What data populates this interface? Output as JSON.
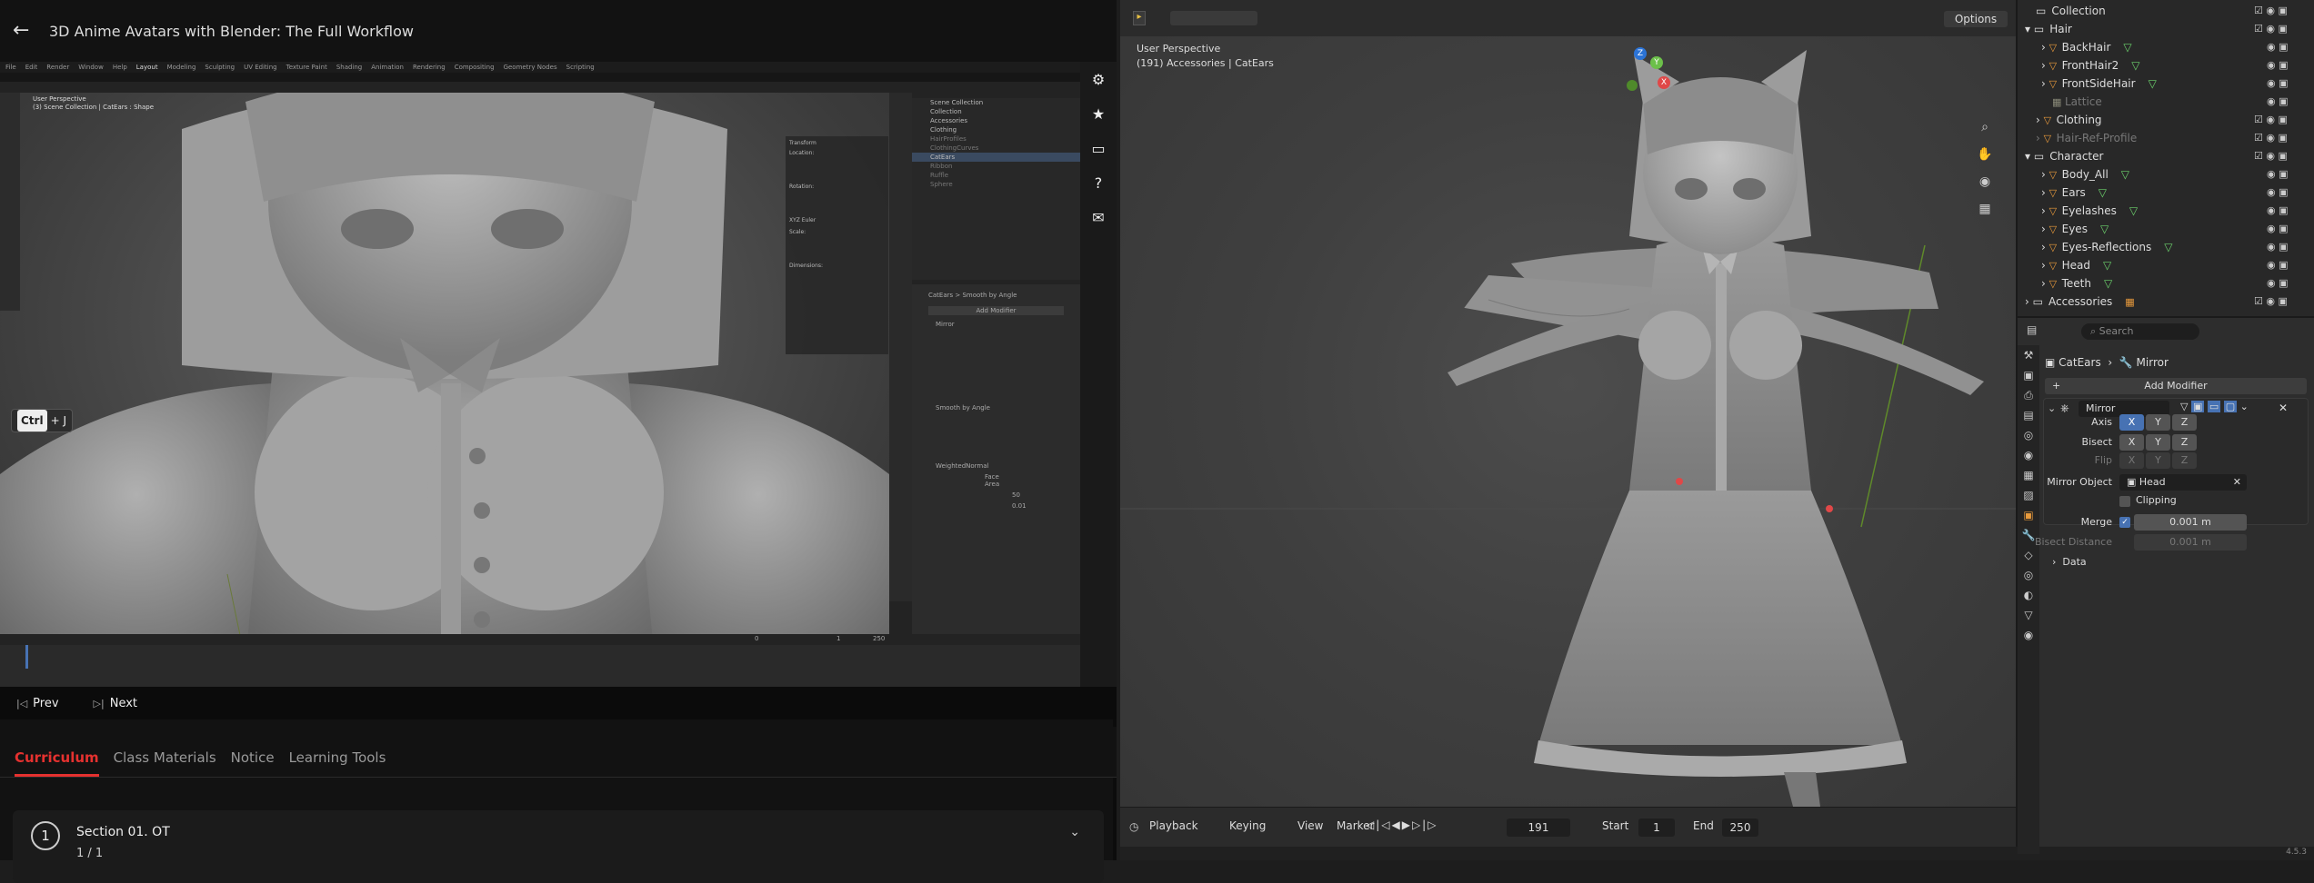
{
  "course": {
    "title": "3D Anime Avatars with Blender: The Full Workflow"
  },
  "video": {
    "menubar": [
      "File",
      "Edit",
      "Render",
      "Window",
      "Help",
      "Layout",
      "Modeling",
      "Sculpting",
      "UV Editing",
      "Texture Paint",
      "Shading",
      "Animation",
      "Rendering",
      "Compositing",
      "Geometry Nodes",
      "Scripting"
    ],
    "viewport_info": [
      "User Perspective",
      "(3) Scene Collection | CatEars : Shape"
    ],
    "shortcut": {
      "key": "Ctrl",
      "plus": "+ J"
    },
    "outliner": [
      "Scene Collection",
      "Collection",
      "Accessories",
      "Clothing",
      "HairProfiles",
      "ClothingCurves",
      "CatEars",
      "Ribbon",
      "Ruffle",
      "Sphere"
    ],
    "props": {
      "breadcrumb": "CatEars  >  Smooth by Angle",
      "add_modifier": "Add Modifier",
      "mirror": "Mirror",
      "smooth": "Smooth by Angle",
      "weighted": "WeightedNormal",
      "weighting_mode": "Face Area",
      "weight": "50",
      "threshold": "0.01"
    },
    "transform": {
      "title": "Transform",
      "location": "Location:",
      "rotation": "Rotation:",
      "scale": "Scale:",
      "dimensions": "Dimensions:",
      "rotation_mode": "XYZ Euler"
    },
    "timeline": {
      "frame": "0",
      "start": "1",
      "end": "250"
    }
  },
  "nav": {
    "prev": "Prev",
    "next": "Next"
  },
  "tabs": [
    {
      "label": "Curriculum",
      "active": true
    },
    {
      "label": "Class Materials",
      "active": false
    },
    {
      "label": "Notice",
      "active": false
    },
    {
      "label": "Learning Tools",
      "active": false
    }
  ],
  "section": {
    "num": "1",
    "title": "Section 01. OT",
    "progress": "1 / 1"
  },
  "blender": {
    "options_label": "Options",
    "viewport_info": [
      "User Perspective",
      "(191) Accessories | CatEars"
    ],
    "gizmo": {
      "x": "X",
      "y": "Y",
      "z": "Z"
    },
    "timeline": {
      "playback": "Playback",
      "keying": "Keying",
      "view": "View",
      "marker": "Marker",
      "frame": "191",
      "start_label": "Start",
      "start": "1",
      "end_label": "End",
      "end": "250"
    },
    "version": "4.5.3",
    "outliner": [
      {
        "label": "Collection",
        "indent": 1,
        "dim": false
      },
      {
        "label": "Hair",
        "indent": 1,
        "dim": false
      },
      {
        "label": "BackHair",
        "indent": 2,
        "dim": false
      },
      {
        "label": "FrontHair2",
        "indent": 2,
        "dim": false
      },
      {
        "label": "FrontSideHair",
        "indent": 2,
        "dim": false
      },
      {
        "label": "Lattice",
        "indent": 2,
        "dim": true
      },
      {
        "label": "Clothing",
        "indent": 1,
        "dim": false
      },
      {
        "label": "Hair-Ref-Profile",
        "indent": 1,
        "dim": true
      },
      {
        "label": "Character",
        "indent": 1,
        "dim": false
      },
      {
        "label": "Body_All",
        "indent": 2,
        "dim": false
      },
      {
        "label": "Ears",
        "indent": 2,
        "dim": false
      },
      {
        "label": "Eyelashes",
        "indent": 2,
        "dim": false
      },
      {
        "label": "Eyes",
        "indent": 2,
        "dim": false
      },
      {
        "label": "Eyes-Reflections",
        "indent": 2,
        "dim": false
      },
      {
        "label": "Head",
        "indent": 2,
        "dim": false
      },
      {
        "label": "Teeth",
        "indent": 2,
        "dim": false
      },
      {
        "label": "Accessories",
        "indent": 1,
        "dim": false
      }
    ],
    "props": {
      "search_placeholder": "Search",
      "obj": "CatEars",
      "modifier": "Mirror",
      "add_modifier": "Add Modifier",
      "axis_label": "Axis",
      "bisect_label": "Bisect",
      "flip_label": "Flip",
      "axis_x": "X",
      "axis_y": "Y",
      "axis_z": "Z",
      "mirror_object_label": "Mirror Object",
      "mirror_object": "Head",
      "clipping": "Clipping",
      "merge_label": "Merge",
      "merge": "0.001 m",
      "bisect_distance_label": "Bisect Distance",
      "bisect_distance": "0.001 m",
      "data": "Data"
    }
  }
}
